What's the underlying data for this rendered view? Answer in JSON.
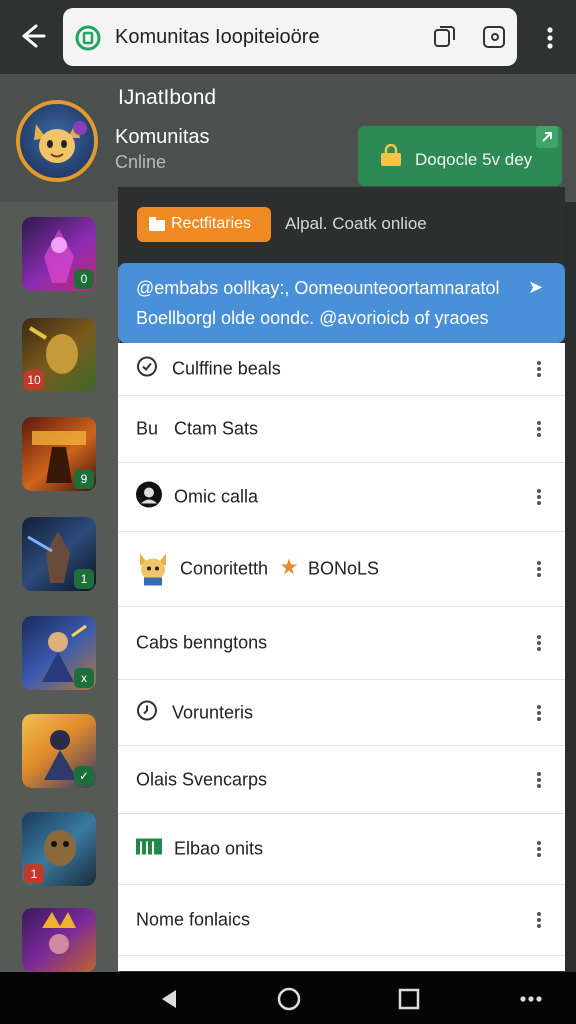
{
  "browser": {
    "back_icon": "arrow-left-icon",
    "url_text": "Komunitas Ioopiteioöre",
    "menu_icon": "kebab-icon"
  },
  "header": {
    "channel_title": "IJnatIbond",
    "profile_name": "Komunitas",
    "profile_status": "Cnline",
    "notification_card_label": "Doqocle 5v dey"
  },
  "games": [
    {
      "name": "game-1",
      "badge": "0"
    },
    {
      "name": "game-2",
      "badge": "10"
    },
    {
      "name": "game-3",
      "badge": "9"
    },
    {
      "name": "game-4",
      "badge": "1"
    },
    {
      "name": "game-5",
      "badge": "x"
    },
    {
      "name": "game-6",
      "badge": "✓"
    },
    {
      "name": "game-7",
      "badge": "1"
    },
    {
      "name": "game-8",
      "badge": ""
    }
  ],
  "panel": {
    "pill_label": "Rectfitaries",
    "status_text": "Alpal. Coatk onlioe",
    "banner_line1": "@embabs oollkay:, Oomeounteoortamnaratol",
    "banner_line2": "Boellborgl olde oondc. @avorioicb of yraoes"
  },
  "menu_items": [
    {
      "label": "Culffine beals",
      "icon": "clock-icon",
      "prefix": ""
    },
    {
      "label": "Ctam Sats",
      "icon": "",
      "prefix": "Bu"
    },
    {
      "label": "Omic calla",
      "icon": "avatar-icon",
      "prefix": ""
    },
    {
      "label": "Conoritetth",
      "icon": "mascot-icon",
      "prefix": "",
      "extra": "BONoLS"
    },
    {
      "label": "Cabs benngtons",
      "icon": "",
      "prefix": ""
    },
    {
      "label": "Vorunteris",
      "icon": "clock-icon",
      "prefix": ""
    },
    {
      "label": "Olais Svencarps",
      "icon": "",
      "prefix": ""
    },
    {
      "label": "Elbao onits",
      "icon": "bars-icon",
      "prefix": ""
    },
    {
      "label": "Nome fonlaics",
      "icon": "",
      "prefix": ""
    }
  ],
  "colors": {
    "accent_orange": "#f08a23",
    "banner_blue": "#4a90d9",
    "card_green": "#2e8a55",
    "avatar_ring": "#e09a2e"
  },
  "navbar": {
    "back": "triangle-back-icon",
    "home": "circle-home-icon",
    "recents": "square-recents-icon",
    "more": "dots-icon"
  }
}
